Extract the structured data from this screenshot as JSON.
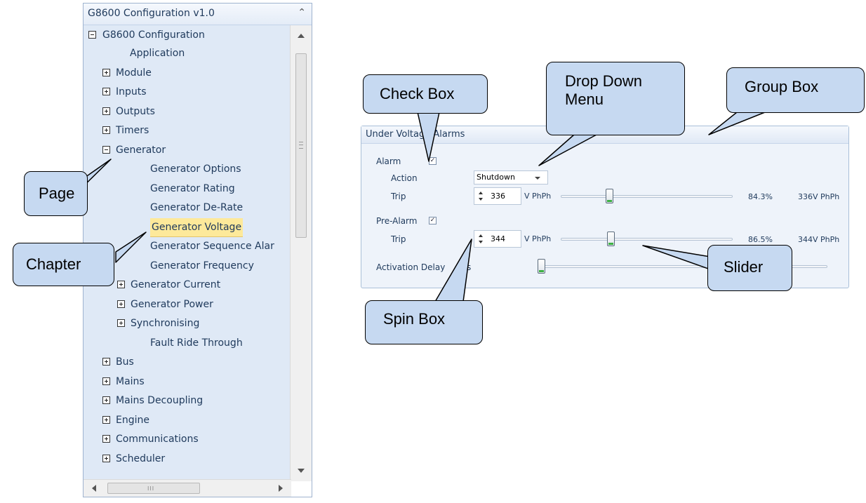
{
  "tree": {
    "title": "G8600 Configuration v1.0",
    "collapse_icon": "≈",
    "root": "G8600 Configuration",
    "items": [
      {
        "label": "Application",
        "expander": "none",
        "level": 2
      },
      {
        "label": "Module",
        "expander": "plus",
        "level": 1
      },
      {
        "label": "Inputs",
        "expander": "plus",
        "level": 1
      },
      {
        "label": "Outputs",
        "expander": "plus",
        "level": 1
      },
      {
        "label": "Timers",
        "expander": "plus",
        "level": 1
      },
      {
        "label": "Generator",
        "expander": "minus",
        "level": 1
      },
      {
        "label": "Generator Options",
        "expander": "none",
        "level": 3
      },
      {
        "label": "Generator Rating",
        "expander": "none",
        "level": 3
      },
      {
        "label": "Generator De-Rate",
        "expander": "none",
        "level": 3
      },
      {
        "label": "Generator Voltage",
        "expander": "none",
        "level": 3,
        "selected": true
      },
      {
        "label": "Generator Sequence Alar",
        "expander": "none",
        "level": 3
      },
      {
        "label": "Generator Frequency",
        "expander": "none",
        "level": 3
      },
      {
        "label": "Generator Current",
        "expander": "plus",
        "level": 2
      },
      {
        "label": "Generator Power",
        "expander": "plus",
        "level": 2
      },
      {
        "label": "Synchronising",
        "expander": "plus",
        "level": 2
      },
      {
        "label": "Fault Ride Through",
        "expander": "none",
        "level": 3
      },
      {
        "label": "Bus",
        "expander": "plus",
        "level": 1
      },
      {
        "label": "Mains",
        "expander": "plus",
        "level": 1
      },
      {
        "label": "Mains Decoupling",
        "expander": "plus",
        "level": 1
      },
      {
        "label": "Engine",
        "expander": "plus",
        "level": 1
      },
      {
        "label": "Communications",
        "expander": "plus",
        "level": 1
      },
      {
        "label": "Scheduler",
        "expander": "plus",
        "level": 1
      }
    ],
    "hscroll_grip": "III"
  },
  "group": {
    "title": "Under Voltage Alarms",
    "alarm_label": "Alarm",
    "alarm_checked": true,
    "action_label": "Action",
    "action_value": "Shutdown",
    "trip_label": "Trip",
    "trip_value": "336",
    "trip_unit": "V PhPh",
    "trip_percent": "84.3%",
    "trip_readout": "336V PhPh",
    "trip_slider_level": 0.28,
    "prealarm_label": "Pre-Alarm",
    "prealarm_checked": true,
    "pretrip_label": "Trip",
    "pretrip_value": "344",
    "pretrip_unit": "V PhPh",
    "pretrip_percent": "86.5%",
    "pretrip_readout": "344V PhPh",
    "pretrip_slider_level": 0.29,
    "delay_label": "Activation Delay",
    "delay_suffix": "s",
    "delay_slider_level": 0.0
  },
  "callouts": {
    "check_box": "Check Box",
    "drop_down": [
      "Drop Down",
      "Menu"
    ],
    "group_box": "Group Box",
    "page": "Page",
    "chapter": "Chapter",
    "slider": "Slider",
    "spin_box": "Spin Box"
  },
  "colors": {
    "callout_fill": "#c6d9f1",
    "tree_bg": "#dfe9f6",
    "selected_highlight": "#fde99a",
    "text": "#1e395b"
  }
}
